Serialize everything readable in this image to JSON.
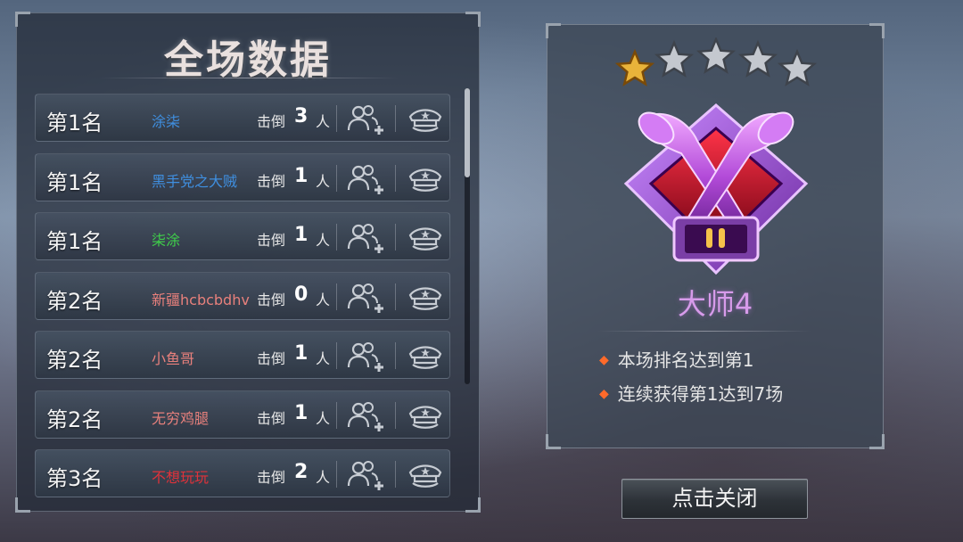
{
  "panel_title": "全场数据",
  "kill_label": "击倒",
  "kill_unit": "人",
  "players": [
    {
      "rank": "第1名",
      "name": "涂柒",
      "name_color": "#3f8fe0",
      "kills": "3"
    },
    {
      "rank": "第1名",
      "name": "黑手党之大贼",
      "name_color": "#3f8fe0",
      "kills": "1"
    },
    {
      "rank": "第1名",
      "name": "柒涂",
      "name_color": "#3fd04a",
      "kills": "1"
    },
    {
      "rank": "第2名",
      "name": "新疆hcbcbdhv",
      "name_color": "#e8807c",
      "kills": "0"
    },
    {
      "rank": "第2名",
      "name": "小鱼哥",
      "name_color": "#e8807c",
      "kills": "1"
    },
    {
      "rank": "第2名",
      "name": "无穷鸡腿",
      "name_color": "#e8807c",
      "kills": "1"
    },
    {
      "rank": "第3名",
      "name": "不想玩玩",
      "name_color": "#e0323a",
      "kills": "2"
    }
  ],
  "rank_stars": {
    "filled": 1,
    "total": 5
  },
  "rank_name": "大师4",
  "achievements": [
    "本场排名达到第1",
    "连续获得第1达到7场"
  ],
  "close_button_label": "点击关闭",
  "icons": {
    "add_friend": "add-friend-icon",
    "profile": "officer-cap-icon",
    "star": "star-icon",
    "rank_emblem": "rocket-emblem-icon"
  }
}
